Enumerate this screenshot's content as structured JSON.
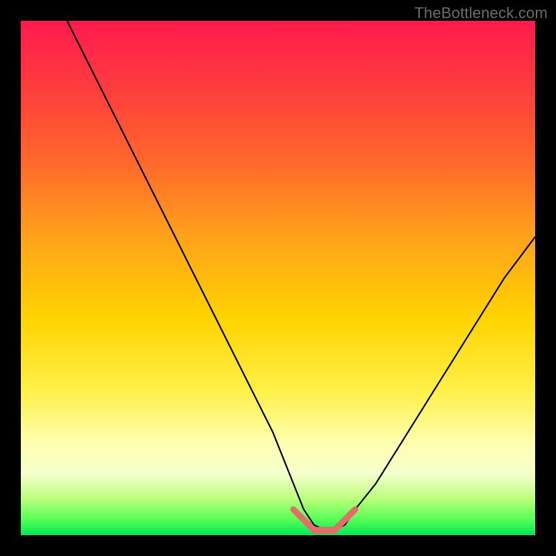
{
  "watermark": "TheBottleneck.com",
  "chart_data": {
    "type": "line",
    "title": "",
    "xlabel": "",
    "ylabel": "",
    "xlim": [
      0,
      100
    ],
    "ylim": [
      0,
      100
    ],
    "grid": false,
    "series": [
      {
        "name": "bottleneck-curve",
        "color": "#000000",
        "x": [
          9,
          14,
          19,
          24,
          29,
          34,
          39,
          44,
          49,
          53,
          55,
          57,
          59,
          61,
          63,
          65,
          69,
          74,
          79,
          84,
          89,
          94,
          100
        ],
        "y": [
          100,
          90,
          80,
          70,
          60,
          50,
          40,
          30,
          20,
          10,
          5,
          2,
          1,
          1,
          2,
          5,
          10,
          18,
          26,
          34,
          42,
          50,
          58
        ]
      },
      {
        "name": "optimal-range-marker",
        "color": "#e86a6a",
        "x": [
          53,
          54,
          55,
          56,
          57,
          58,
          59,
          60,
          61,
          62,
          63,
          64,
          65
        ],
        "y": [
          5,
          4,
          3,
          2,
          1,
          1,
          1,
          1,
          1,
          2,
          3,
          4,
          5
        ]
      }
    ],
    "background_gradient": {
      "orientation": "vertical",
      "stops": [
        {
          "pos": 0.0,
          "color": "#ff1a4d"
        },
        {
          "pos": 0.12,
          "color": "#ff3a3f"
        },
        {
          "pos": 0.28,
          "color": "#ff6a2a"
        },
        {
          "pos": 0.42,
          "color": "#ffa21a"
        },
        {
          "pos": 0.58,
          "color": "#ffd400"
        },
        {
          "pos": 0.72,
          "color": "#fff04a"
        },
        {
          "pos": 0.82,
          "color": "#ffffb0"
        },
        {
          "pos": 0.88,
          "color": "#f5ffcc"
        },
        {
          "pos": 0.93,
          "color": "#b9ff7a"
        },
        {
          "pos": 0.97,
          "color": "#55ff55"
        },
        {
          "pos": 1.0,
          "color": "#00e85a"
        }
      ]
    }
  },
  "colors": {
    "frame": "#000000",
    "curve": "#000000",
    "marker": "#e86a6a",
    "watermark": "#6d6d6d"
  }
}
